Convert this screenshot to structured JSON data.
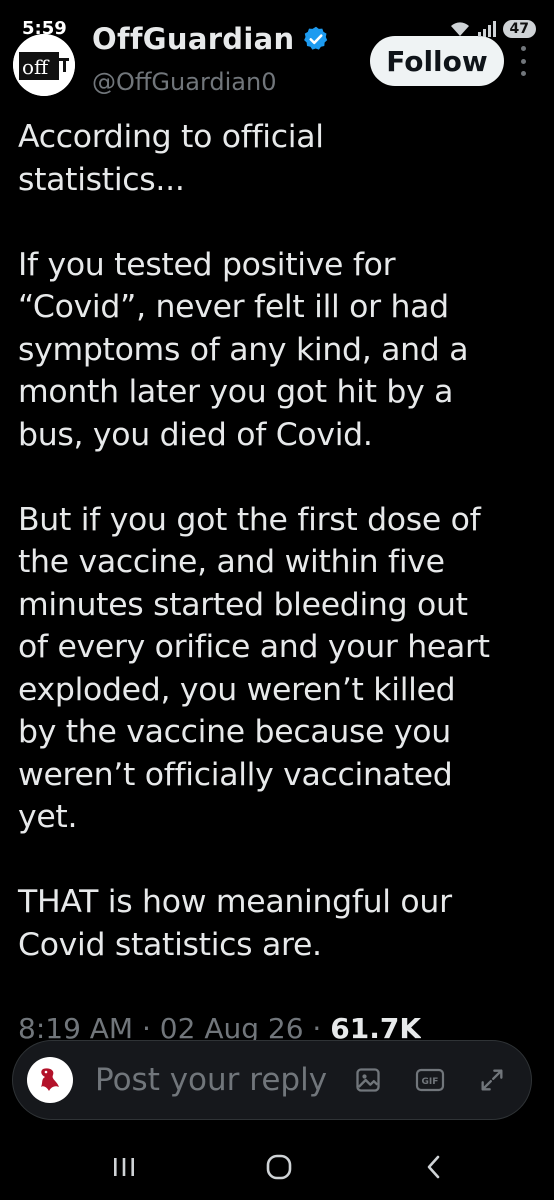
{
  "status_bar": {
    "time": "5:59",
    "battery": "47"
  },
  "header": {
    "avatar_text": "off",
    "display_name": "OffGuardian",
    "handle": "@OffGuardian0",
    "follow_label": "Follow"
  },
  "tweet": {
    "paragraphs": [
      "According to official\nstatistics...",
      "If you tested positive for\n“Covid”, never felt ill or had\nsymptoms of any kind, and a\nmonth later you got hit by a\nbus, you died of Covid.",
      "But if you got the first dose of\nthe vaccine, and within five\nminutes started bleeding out\nof every orifice and your heart\nexploded, you weren’t killed\nby the vaccine because you\nweren’t officially vaccinated\nyet.",
      "THAT is how meaningful  our\nCovid statistics are."
    ],
    "meta_time_date": "8:19 AM · 02 Aug 26 · ",
    "meta_views": "61.7K"
  },
  "reply": {
    "placeholder": "Post your reply",
    "gif_label": "GIF"
  },
  "icons": {
    "verified": "verified-badge-icon",
    "more": "more-vertical-icon",
    "image": "image-icon",
    "gif": "gif-icon",
    "expand": "expand-icon",
    "recents": "recents-icon",
    "home": "home-icon",
    "back": "back-icon"
  },
  "colors": {
    "verified_blue": "#1d9bf0",
    "secondary_text": "#71767b",
    "primary_text": "#e7e9ea"
  }
}
